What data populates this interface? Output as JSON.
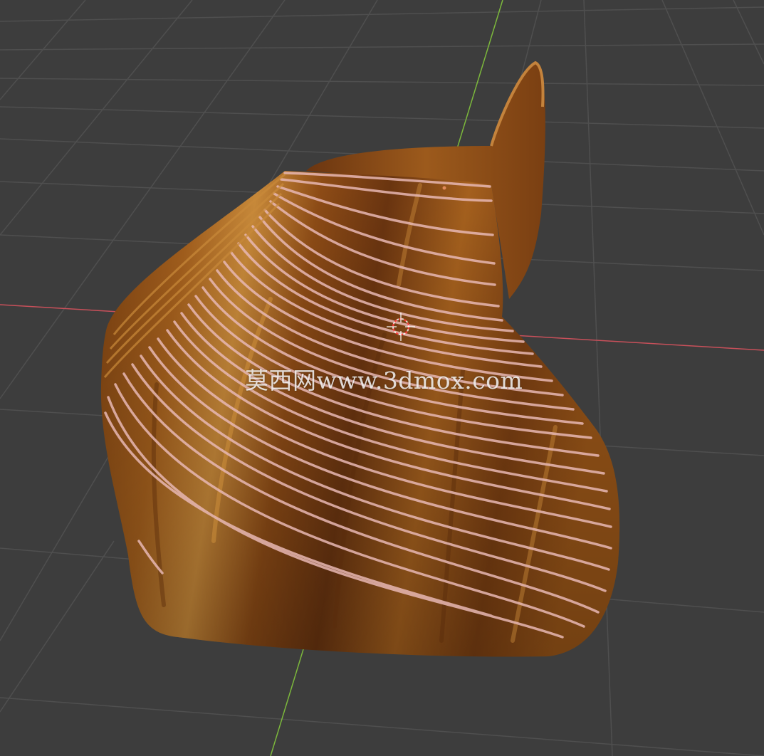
{
  "viewport": {
    "background_color": "#3d3d3d",
    "grid_color": "#4f4f4f",
    "x_axis_color": "#c8505a",
    "y_axis_color": "#7cb83c"
  },
  "model": {
    "material_colors": [
      "#8a4a14",
      "#b06820",
      "#c98a3a",
      "#6b3510"
    ],
    "slat_highlight_color": "#e8b8b4"
  },
  "cursor": {
    "icon": "3d-cursor-icon",
    "colors": [
      "#ff4040",
      "#ffffff"
    ]
  },
  "watermark": {
    "text": "莫西网www.3dmox.com"
  }
}
